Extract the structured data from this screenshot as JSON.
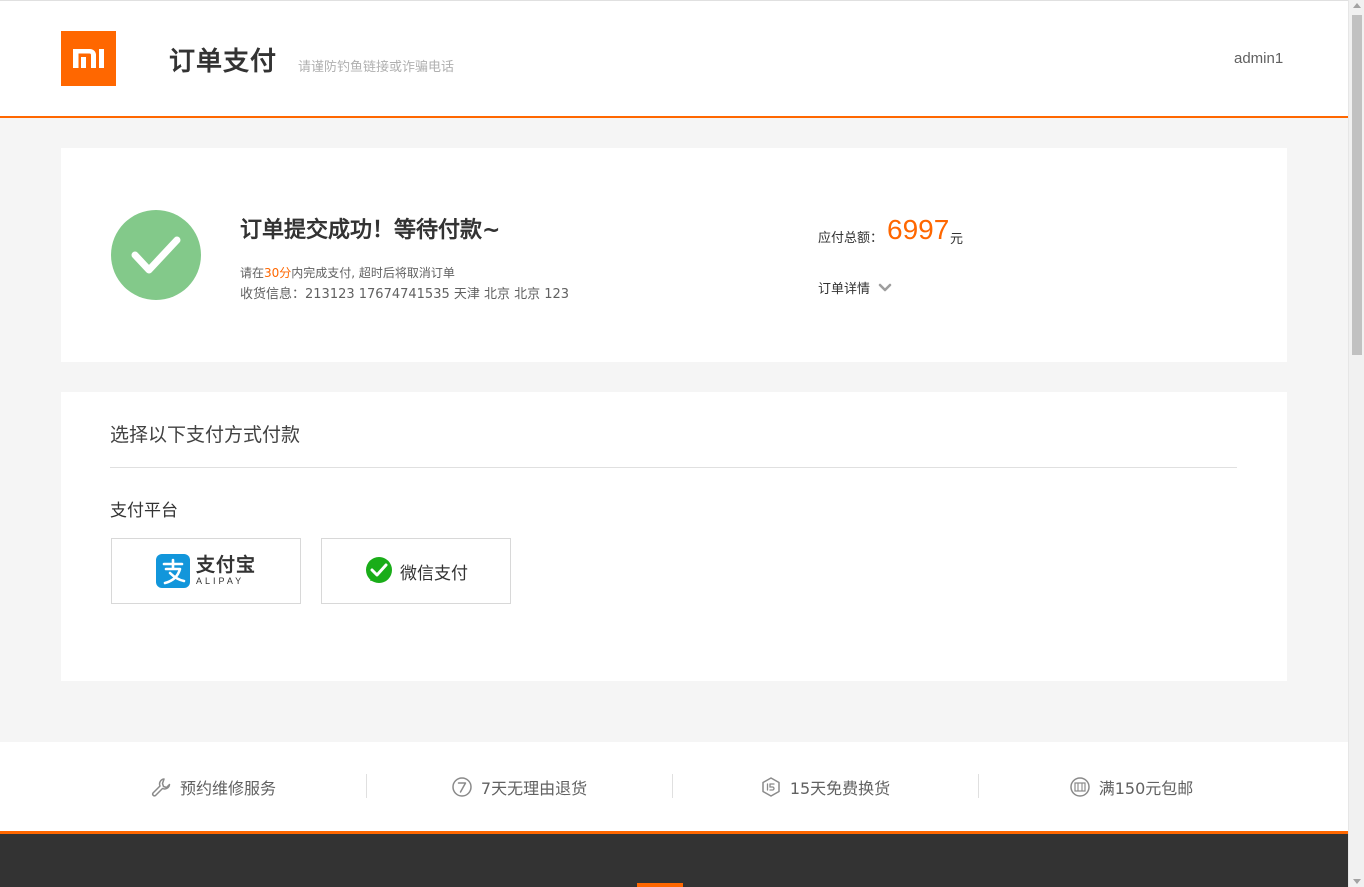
{
  "header": {
    "logo_text": "MI",
    "title": "订单支付",
    "subtitle": "请谨防钓鱼链接或诈骗电话",
    "username": "admin1"
  },
  "order": {
    "success_title": "订单提交成功！等待付款~",
    "tip_prefix": "请在",
    "tip_time": "30分",
    "tip_suffix": "内完成支付, 超时后将取消订单",
    "ship_info": "收货信息：213123 17674741535 天津 北京 北京 123",
    "amount_label": "应付总额：",
    "amount_value": "6997",
    "amount_unit": "元",
    "detail_label": "订单详情"
  },
  "payment": {
    "heading": "选择以下支付方式付款",
    "platform_label": "支付平台",
    "alipay_name": "支付宝",
    "alipay_en": "ALIPAY",
    "wechat_name": "微信支付"
  },
  "services": [
    {
      "label": "预约维修服务",
      "icon": "wrench-icon"
    },
    {
      "label": "7天无理由退货",
      "icon": "seven-day-return-icon"
    },
    {
      "label": "15天免费换货",
      "icon": "fifteen-day-exchange-icon"
    },
    {
      "label": "满150元包邮",
      "icon": "free-shipping-icon"
    }
  ],
  "colors": {
    "brand": "#ff6700",
    "success": "#83c98a",
    "alipay": "#1296db",
    "wechat": "#1aad19"
  }
}
